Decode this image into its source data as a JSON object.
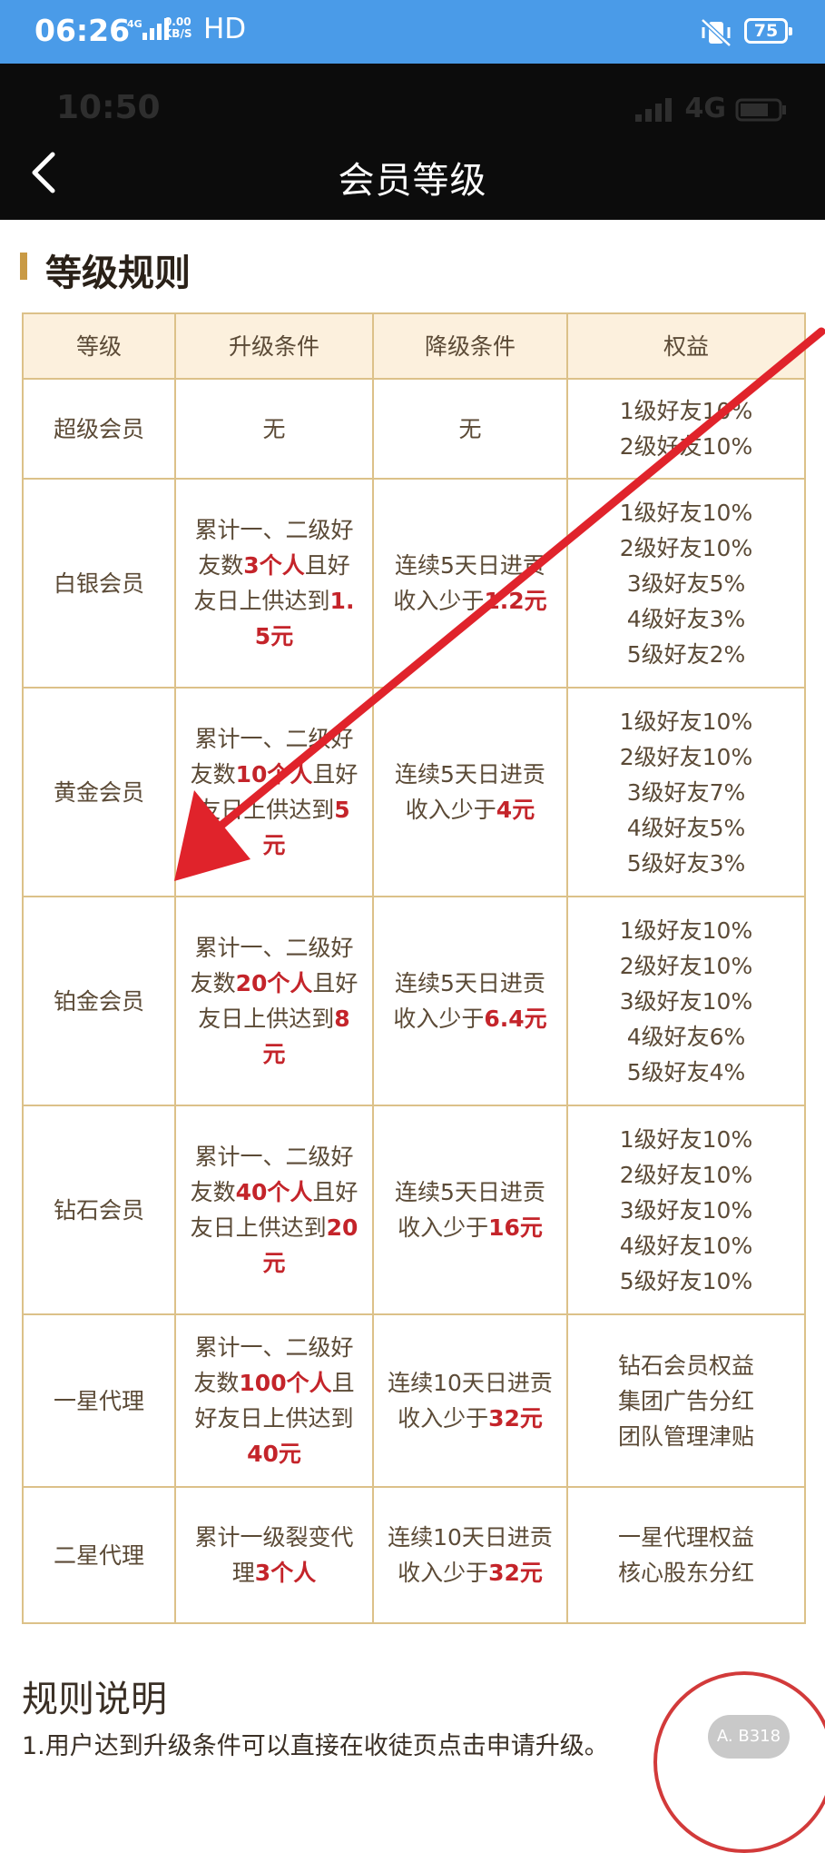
{
  "phone_status": {
    "time": "06:26",
    "network": "4G",
    "speed_value": "0.00",
    "speed_unit": "KB/S",
    "hd": "HD",
    "battery": "75"
  },
  "inner_status": {
    "time": "10:50",
    "network": "4G"
  },
  "appbar": {
    "title": "会员等级"
  },
  "section": {
    "title": "等级规则"
  },
  "table": {
    "headers": [
      "等级",
      "升级条件",
      "降级条件",
      "权益"
    ],
    "rows": [
      {
        "level": "超级会员",
        "upgrade": [
          "无"
        ],
        "downgrade": [
          "无"
        ],
        "benefits": [
          "1级好友10%",
          "2级好友10%"
        ]
      },
      {
        "level": "白银会员",
        "upgrade": [
          "累计一、二级好",
          "友数",
          "3个人",
          "且好",
          "友日上供达到",
          "1.5元"
        ],
        "downgrade": [
          "连续5天日进贡",
          "收入少于",
          "1.2元"
        ],
        "benefits": [
          "1级好友10%",
          "2级好友10%",
          "3级好友5%",
          "4级好友3%",
          "5级好友2%"
        ]
      },
      {
        "level": "黄金会员",
        "upgrade": [
          "累计一、二级好",
          "友数",
          "10个人",
          "且好",
          "友日上供达到",
          "5",
          "元"
        ],
        "downgrade": [
          "连续5天日进贡",
          "收入少于",
          "4元"
        ],
        "benefits": [
          "1级好友10%",
          "2级好友10%",
          "3级好友7%",
          "4级好友5%",
          "5级好友3%"
        ]
      },
      {
        "level": "铂金会员",
        "upgrade": [
          "累计一、二级好",
          "友数",
          "20个人",
          "且",
          "好友日上供达到",
          "8元"
        ],
        "downgrade": [
          "连续5天日进贡",
          "收入少于",
          "6.4元"
        ],
        "benefits": [
          "1级好友10%",
          "2级好友10%",
          "3级好友10%",
          "4级好友6%",
          "5级好友4%"
        ]
      },
      {
        "level": "钻石会员",
        "upgrade": [
          "累计一、二级好",
          "友数",
          "40个人",
          "且",
          "好友日上供达到",
          "20元"
        ],
        "downgrade": [
          "连续5天日进贡",
          "收入少于",
          "16元"
        ],
        "benefits": [
          "1级好友10%",
          "2级好友10%",
          "3级好友10%",
          "4级好友10%",
          "5级好友10%"
        ]
      },
      {
        "level": "一星代理",
        "upgrade": [
          "累计一、二级好",
          "友数",
          "100个人",
          "且",
          "好友日上供达到",
          "40元"
        ],
        "downgrade": [
          "连续10天日进",
          "贡收入少于",
          "32",
          "元"
        ],
        "benefits": [
          "钻石会员权益",
          "集团广告分红",
          "团队管理津贴"
        ]
      },
      {
        "level": "二星代理",
        "upgrade": [
          "累计一级裂变代",
          "理",
          "3个人"
        ],
        "downgrade": [
          "连续10天日进",
          "贡收入少于",
          "32",
          "元"
        ],
        "benefits": [
          "一星代理权益",
          "核心股东分红"
        ]
      }
    ]
  },
  "rules": {
    "title": "规则说明",
    "first_line": "1.用户达到升级条件可以直接在收徒页点击申请升级。"
  },
  "annotation": {
    "arrow_color": "#e0232b",
    "seal_text": "A. B318"
  }
}
